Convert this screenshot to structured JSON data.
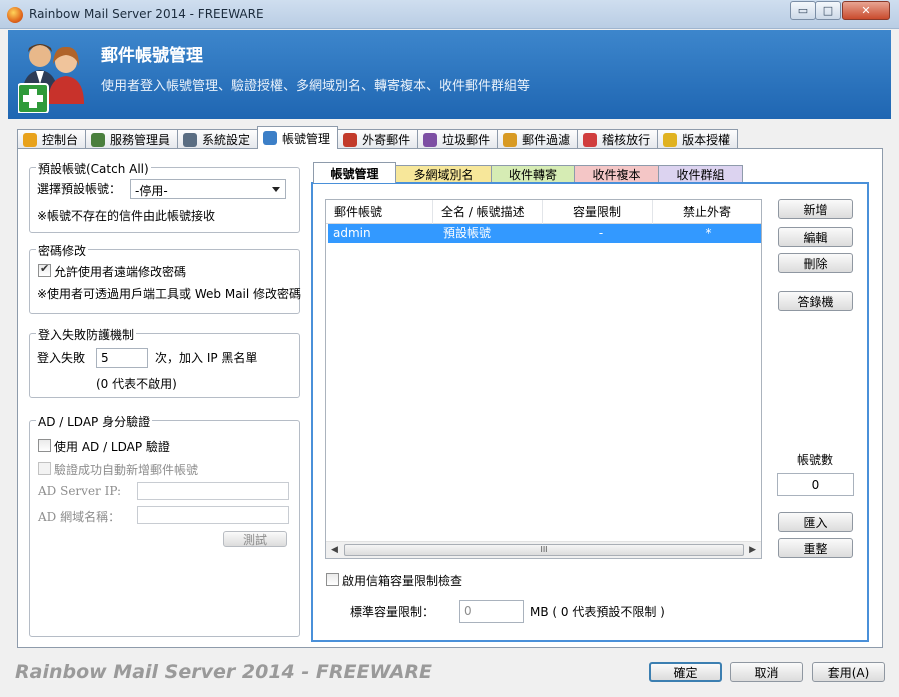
{
  "window": {
    "title": "Rainbow Mail Server 2014 - FREEWARE",
    "min": "▭",
    "max": "□",
    "close": "✕"
  },
  "header": {
    "title": "郵件帳號管理",
    "description": "使用者登入帳號管理、驗證授權、多網域別名、轉寄複本、收件郵件群組等"
  },
  "tabs": [
    {
      "label": "控制台",
      "icon": "dashboard-icon",
      "color": "#e8a21c"
    },
    {
      "label": "服務管理員",
      "icon": "services-icon",
      "color": "#4a7f3d"
    },
    {
      "label": "系統設定",
      "icon": "gear-icon",
      "color": "#5a6d82"
    },
    {
      "label": "帳號管理",
      "icon": "users-icon",
      "color": "#3c7fc7"
    },
    {
      "label": "外寄郵件",
      "icon": "outgoing-mail-icon",
      "color": "#c23a2a"
    },
    {
      "label": "垃圾郵件",
      "icon": "spam-icon",
      "color": "#7d4fa3"
    },
    {
      "label": "郵件過濾",
      "icon": "filter-icon",
      "color": "#d89a23"
    },
    {
      "label": "稽核放行",
      "icon": "audit-icon",
      "color": "#d03d3d"
    },
    {
      "label": "版本授權",
      "icon": "license-icon",
      "color": "#e0b220"
    }
  ],
  "catchall": {
    "legend": "預設帳號(Catch All)",
    "label": "選擇預設帳號：",
    "value": "-停用-",
    "note": "※帳號不存在的信件由此帳號接收"
  },
  "password": {
    "legend": "密碼修改",
    "allow_label": "允許使用者遠端修改密碼",
    "allow_checked": true,
    "note": "※使用者可透過用戶端工具或 Web Mail 修改密碼"
  },
  "login_fail": {
    "legend": "登入失敗防護機制",
    "prefix": "登入失敗",
    "value": "5",
    "suffix": "次，加入 IP 黑名單",
    "note": "(0 代表不啟用)"
  },
  "ldap": {
    "legend": "AD / LDAP 身分驗證",
    "use_label": "使用 AD / LDAP 驗證",
    "auto_label": "驗證成功自動新增郵件帳號",
    "server_label": "AD Server IP:",
    "server_value": "",
    "domain_label": "AD 網域名稱：",
    "domain_value": "",
    "test_label": "測試"
  },
  "subtabs": [
    {
      "label": "帳號管理",
      "color": "#ffffff",
      "width": 83
    },
    {
      "label": "多網域別名",
      "color": "#f7e79a",
      "width": 97
    },
    {
      "label": "收件轉寄",
      "color": "#d6ecb4",
      "width": 84
    },
    {
      "label": "收件複本",
      "color": "#f4c6c6",
      "width": 85
    },
    {
      "label": "收件群組",
      "color": "#dcd3f0",
      "width": 85
    }
  ],
  "list": {
    "columns": [
      "郵件帳號",
      "全名 / 帳號描述",
      "容量限制",
      "禁止外寄"
    ],
    "rows": [
      {
        "account": "admin",
        "name": "預設帳號",
        "quota": "-",
        "block": "*"
      }
    ]
  },
  "side_buttons": {
    "add": "新增",
    "edit": "編輯",
    "delete": "刪除",
    "ban": "答錄機",
    "import": "匯入",
    "reset": "重整"
  },
  "account_count": {
    "label": "帳號數",
    "value": "0"
  },
  "quota": {
    "enable_label": "啟用信箱容量限制檢查",
    "std_label": "標準容量限制：",
    "value": "0",
    "unit": "MB ( 0 代表預設不限制 )"
  },
  "footer": {
    "brand": "Rainbow Mail Server 2014 - FREEWARE",
    "ok": "確定",
    "cancel": "取消",
    "apply": "套用(A)"
  }
}
